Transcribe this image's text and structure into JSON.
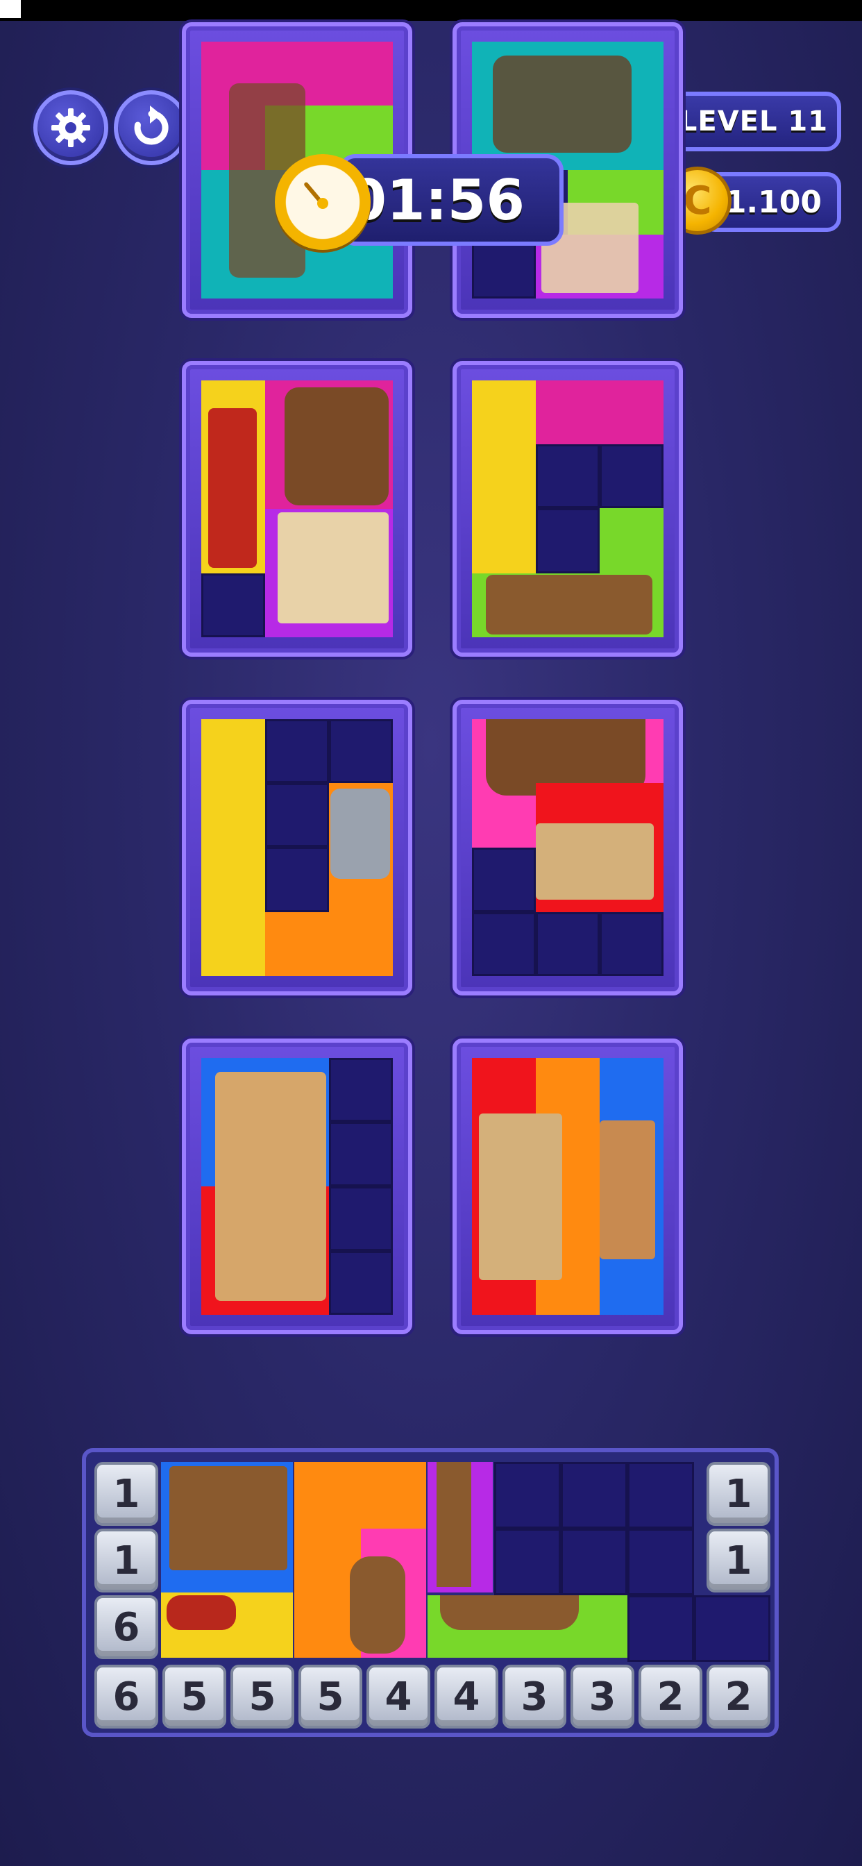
{
  "hud": {
    "level_label": "LEVEL 11",
    "coins": "1.100",
    "timer": "01:56",
    "settings_icon": "gear-icon",
    "restart_icon": "restart-icon",
    "coin_icon": "coin-icon",
    "coin_letter": "C"
  },
  "colors": {
    "magenta": "#e0239c",
    "purple": "#b72ae6",
    "teal": "#10b3b7",
    "lime": "#78d82a",
    "yellow": "#f5d21c",
    "orange": "#ff8a10",
    "red": "#f0141c",
    "blue": "#1f6cf0",
    "pink": "#ff3cb2"
  },
  "tray": {
    "left_numbers": [
      "1",
      "1",
      "6"
    ],
    "right_numbers": [
      "1",
      "1"
    ],
    "bottom_numbers": [
      "6",
      "5",
      "5",
      "5",
      "4",
      "4",
      "3",
      "3",
      "2",
      "2"
    ]
  }
}
